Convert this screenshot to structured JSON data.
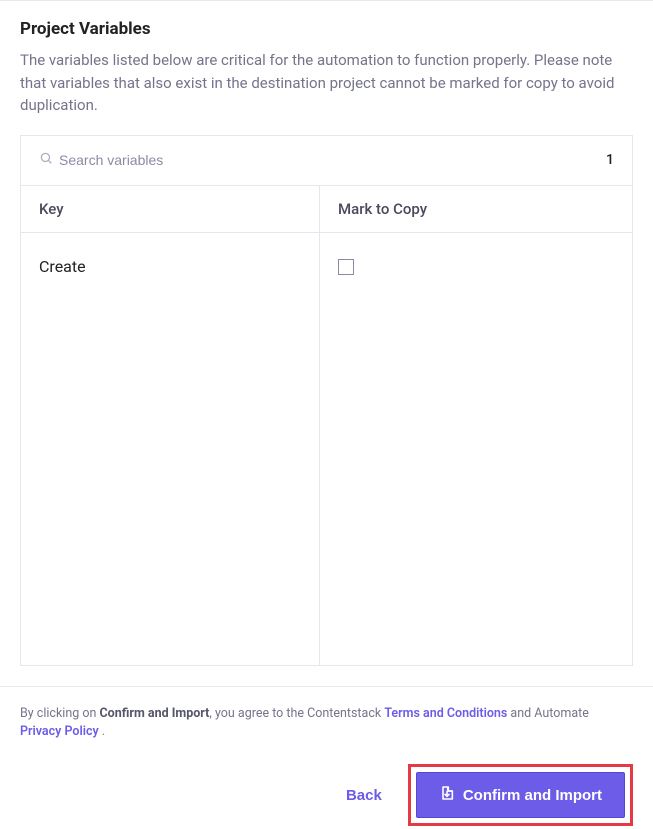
{
  "header": {
    "title": "Project Variables",
    "description": "The variables listed below are critical for the automation to function properly. Please note that variables that also exist in the destination project cannot be marked for copy to avoid duplication."
  },
  "search": {
    "placeholder": "Search variables",
    "count": "1"
  },
  "table": {
    "columns": {
      "key": "Key",
      "mark": "Mark to Copy"
    },
    "rows": [
      {
        "key": "Create",
        "checked": false
      }
    ]
  },
  "footer": {
    "agree_prefix": "By clicking on ",
    "agree_bold": "Confirm and Import",
    "agree_mid": ", you agree to the Contentstack ",
    "terms_link": "Terms and Conditions",
    "agree_and": " and Automate ",
    "privacy_link": "Privacy Policy",
    "agree_suffix": " ."
  },
  "buttons": {
    "back": "Back",
    "confirm": "Confirm and Import"
  },
  "colors": {
    "accent": "#6c5ce7",
    "highlight_border": "#e63946"
  }
}
